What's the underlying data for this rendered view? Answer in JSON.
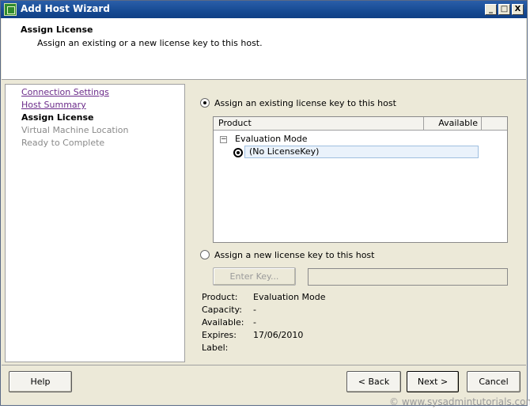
{
  "window": {
    "title": "Add Host Wizard",
    "minimize": "_",
    "maximize": "□",
    "close": "X"
  },
  "header": {
    "title": "Assign License",
    "subtitle": "Assign an existing or a new license key to this host."
  },
  "nav": {
    "items": [
      {
        "label": "Connection Settings",
        "state": "link"
      },
      {
        "label": "Host Summary",
        "state": "link"
      },
      {
        "label": "Assign License",
        "state": "current"
      },
      {
        "label": "Virtual Machine Location",
        "state": "disabled"
      },
      {
        "label": "Ready to Complete",
        "state": "disabled"
      }
    ]
  },
  "main": {
    "existing_option": "Assign an existing license key to this host",
    "list": {
      "columns": [
        "Product",
        "Available"
      ],
      "group": {
        "toggle": "−",
        "label": "Evaluation Mode"
      },
      "selected_row": "(No LicenseKey)"
    },
    "new_option": "Assign a new license key to this host",
    "enter_key_button": "Enter Key...",
    "info": [
      {
        "label": "Product:",
        "value": "Evaluation Mode"
      },
      {
        "label": "Capacity:",
        "value": "-"
      },
      {
        "label": "Available:",
        "value": "-"
      },
      {
        "label": "Expires:",
        "value": "17/06/2010"
      },
      {
        "label": "Label:",
        "value": ""
      }
    ]
  },
  "footer": {
    "help": "Help",
    "back": "< Back",
    "next": "Next >",
    "cancel": "Cancel"
  },
  "watermark": "© www.sysadmintutorials.com"
}
